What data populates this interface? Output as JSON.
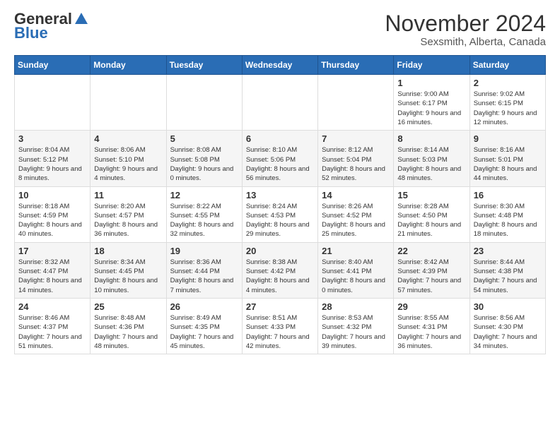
{
  "header": {
    "logo_general": "General",
    "logo_blue": "Blue",
    "month_year": "November 2024",
    "location": "Sexsmith, Alberta, Canada"
  },
  "weekdays": [
    "Sunday",
    "Monday",
    "Tuesday",
    "Wednesday",
    "Thursday",
    "Friday",
    "Saturday"
  ],
  "weeks": [
    [
      {
        "day": "",
        "sunrise": "",
        "sunset": "",
        "daylight": ""
      },
      {
        "day": "",
        "sunrise": "",
        "sunset": "",
        "daylight": ""
      },
      {
        "day": "",
        "sunrise": "",
        "sunset": "",
        "daylight": ""
      },
      {
        "day": "",
        "sunrise": "",
        "sunset": "",
        "daylight": ""
      },
      {
        "day": "",
        "sunrise": "",
        "sunset": "",
        "daylight": ""
      },
      {
        "day": "1",
        "sunrise": "Sunrise: 9:00 AM",
        "sunset": "Sunset: 6:17 PM",
        "daylight": "Daylight: 9 hours and 16 minutes."
      },
      {
        "day": "2",
        "sunrise": "Sunrise: 9:02 AM",
        "sunset": "Sunset: 6:15 PM",
        "daylight": "Daylight: 9 hours and 12 minutes."
      }
    ],
    [
      {
        "day": "3",
        "sunrise": "Sunrise: 8:04 AM",
        "sunset": "Sunset: 5:12 PM",
        "daylight": "Daylight: 9 hours and 8 minutes."
      },
      {
        "day": "4",
        "sunrise": "Sunrise: 8:06 AM",
        "sunset": "Sunset: 5:10 PM",
        "daylight": "Daylight: 9 hours and 4 minutes."
      },
      {
        "day": "5",
        "sunrise": "Sunrise: 8:08 AM",
        "sunset": "Sunset: 5:08 PM",
        "daylight": "Daylight: 9 hours and 0 minutes."
      },
      {
        "day": "6",
        "sunrise": "Sunrise: 8:10 AM",
        "sunset": "Sunset: 5:06 PM",
        "daylight": "Daylight: 8 hours and 56 minutes."
      },
      {
        "day": "7",
        "sunrise": "Sunrise: 8:12 AM",
        "sunset": "Sunset: 5:04 PM",
        "daylight": "Daylight: 8 hours and 52 minutes."
      },
      {
        "day": "8",
        "sunrise": "Sunrise: 8:14 AM",
        "sunset": "Sunset: 5:03 PM",
        "daylight": "Daylight: 8 hours and 48 minutes."
      },
      {
        "day": "9",
        "sunrise": "Sunrise: 8:16 AM",
        "sunset": "Sunset: 5:01 PM",
        "daylight": "Daylight: 8 hours and 44 minutes."
      }
    ],
    [
      {
        "day": "10",
        "sunrise": "Sunrise: 8:18 AM",
        "sunset": "Sunset: 4:59 PM",
        "daylight": "Daylight: 8 hours and 40 minutes."
      },
      {
        "day": "11",
        "sunrise": "Sunrise: 8:20 AM",
        "sunset": "Sunset: 4:57 PM",
        "daylight": "Daylight: 8 hours and 36 minutes."
      },
      {
        "day": "12",
        "sunrise": "Sunrise: 8:22 AM",
        "sunset": "Sunset: 4:55 PM",
        "daylight": "Daylight: 8 hours and 32 minutes."
      },
      {
        "day": "13",
        "sunrise": "Sunrise: 8:24 AM",
        "sunset": "Sunset: 4:53 PM",
        "daylight": "Daylight: 8 hours and 29 minutes."
      },
      {
        "day": "14",
        "sunrise": "Sunrise: 8:26 AM",
        "sunset": "Sunset: 4:52 PM",
        "daylight": "Daylight: 8 hours and 25 minutes."
      },
      {
        "day": "15",
        "sunrise": "Sunrise: 8:28 AM",
        "sunset": "Sunset: 4:50 PM",
        "daylight": "Daylight: 8 hours and 21 minutes."
      },
      {
        "day": "16",
        "sunrise": "Sunrise: 8:30 AM",
        "sunset": "Sunset: 4:48 PM",
        "daylight": "Daylight: 8 hours and 18 minutes."
      }
    ],
    [
      {
        "day": "17",
        "sunrise": "Sunrise: 8:32 AM",
        "sunset": "Sunset: 4:47 PM",
        "daylight": "Daylight: 8 hours and 14 minutes."
      },
      {
        "day": "18",
        "sunrise": "Sunrise: 8:34 AM",
        "sunset": "Sunset: 4:45 PM",
        "daylight": "Daylight: 8 hours and 10 minutes."
      },
      {
        "day": "19",
        "sunrise": "Sunrise: 8:36 AM",
        "sunset": "Sunset: 4:44 PM",
        "daylight": "Daylight: 8 hours and 7 minutes."
      },
      {
        "day": "20",
        "sunrise": "Sunrise: 8:38 AM",
        "sunset": "Sunset: 4:42 PM",
        "daylight": "Daylight: 8 hours and 4 minutes."
      },
      {
        "day": "21",
        "sunrise": "Sunrise: 8:40 AM",
        "sunset": "Sunset: 4:41 PM",
        "daylight": "Daylight: 8 hours and 0 minutes."
      },
      {
        "day": "22",
        "sunrise": "Sunrise: 8:42 AM",
        "sunset": "Sunset: 4:39 PM",
        "daylight": "Daylight: 7 hours and 57 minutes."
      },
      {
        "day": "23",
        "sunrise": "Sunrise: 8:44 AM",
        "sunset": "Sunset: 4:38 PM",
        "daylight": "Daylight: 7 hours and 54 minutes."
      }
    ],
    [
      {
        "day": "24",
        "sunrise": "Sunrise: 8:46 AM",
        "sunset": "Sunset: 4:37 PM",
        "daylight": "Daylight: 7 hours and 51 minutes."
      },
      {
        "day": "25",
        "sunrise": "Sunrise: 8:48 AM",
        "sunset": "Sunset: 4:36 PM",
        "daylight": "Daylight: 7 hours and 48 minutes."
      },
      {
        "day": "26",
        "sunrise": "Sunrise: 8:49 AM",
        "sunset": "Sunset: 4:35 PM",
        "daylight": "Daylight: 7 hours and 45 minutes."
      },
      {
        "day": "27",
        "sunrise": "Sunrise: 8:51 AM",
        "sunset": "Sunset: 4:33 PM",
        "daylight": "Daylight: 7 hours and 42 minutes."
      },
      {
        "day": "28",
        "sunrise": "Sunrise: 8:53 AM",
        "sunset": "Sunset: 4:32 PM",
        "daylight": "Daylight: 7 hours and 39 minutes."
      },
      {
        "day": "29",
        "sunrise": "Sunrise: 8:55 AM",
        "sunset": "Sunset: 4:31 PM",
        "daylight": "Daylight: 7 hours and 36 minutes."
      },
      {
        "day": "30",
        "sunrise": "Sunrise: 8:56 AM",
        "sunset": "Sunset: 4:30 PM",
        "daylight": "Daylight: 7 hours and 34 minutes."
      }
    ]
  ]
}
